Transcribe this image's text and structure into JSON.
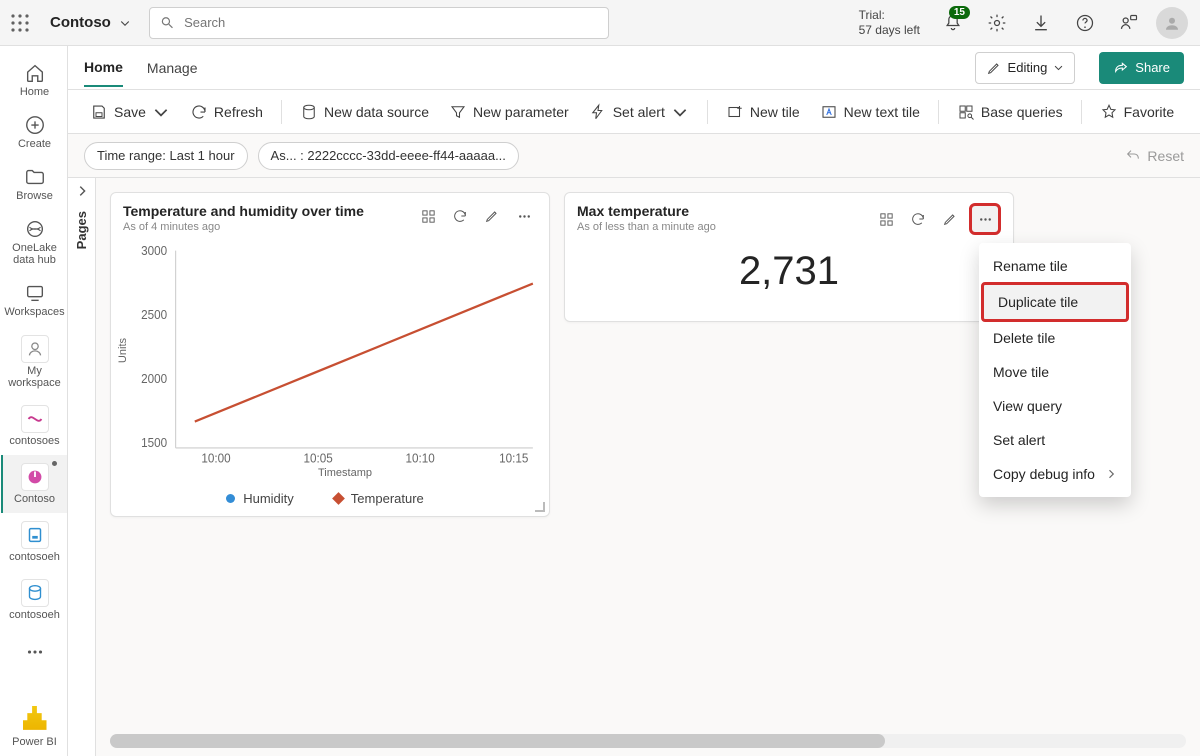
{
  "topbar": {
    "workspace": "Contoso",
    "search_placeholder": "Search",
    "trial_line1": "Trial:",
    "trial_line2": "57 days left",
    "notif_badge": "15"
  },
  "leftrail": {
    "items": [
      {
        "label": "Home"
      },
      {
        "label": "Create"
      },
      {
        "label": "Browse"
      },
      {
        "label": "OneLake data hub"
      },
      {
        "label": "Workspaces"
      },
      {
        "label": "My workspace"
      },
      {
        "label": "contosoes"
      },
      {
        "label": "Contoso"
      },
      {
        "label": "contosoeh"
      },
      {
        "label": "contosoeh"
      }
    ],
    "powerbi": "Power BI"
  },
  "tabs": {
    "home": "Home",
    "manage": "Manage",
    "editing": "Editing",
    "share": "Share"
  },
  "toolbar": {
    "save": "Save",
    "refresh": "Refresh",
    "newds": "New data source",
    "newparam": "New parameter",
    "setalert": "Set alert",
    "newtile": "New tile",
    "newtext": "New text tile",
    "basequeries": "Base queries",
    "favorite": "Favorite"
  },
  "filters": {
    "timerange": "Time range: Last 1 hour",
    "param": "As... : 2222cccc-33dd-eeee-ff44-aaaaa...",
    "reset": "Reset"
  },
  "pagesrail": {
    "label": "Pages"
  },
  "tile1": {
    "title": "Temperature and humidity over time",
    "sub": "As of 4 minutes ago",
    "ylabel": "Units",
    "xlabel": "Timestamp",
    "legend_humidity": "Humidity",
    "legend_temperature": "Temperature"
  },
  "tile2": {
    "title": "Max temperature",
    "sub": "As of less than a minute ago",
    "value": "2,731"
  },
  "ctx": {
    "rename": "Rename tile",
    "duplicate": "Duplicate tile",
    "delete": "Delete tile",
    "move": "Move tile",
    "viewquery": "View query",
    "setalert": "Set alert",
    "copydebug": "Copy debug info"
  },
  "chart_data": {
    "type": "line",
    "xlabel": "Timestamp",
    "ylabel": "Units",
    "ylim": [
      1500,
      3000
    ],
    "x": [
      "10:00",
      "10:05",
      "10:10",
      "10:15"
    ],
    "series": [
      {
        "name": "Temperature",
        "color": "#c74f32",
        "values": [
          1700,
          2050,
          2400,
          2750
        ]
      }
    ],
    "legend": [
      "Humidity",
      "Temperature"
    ]
  }
}
